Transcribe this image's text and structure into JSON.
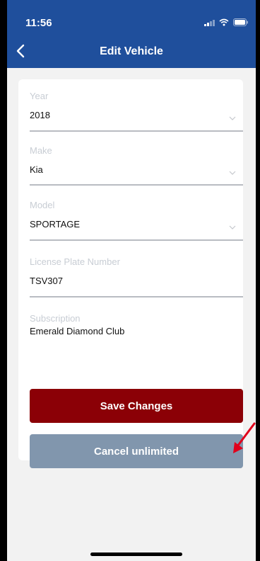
{
  "status_bar": {
    "time": "11:56"
  },
  "nav": {
    "title": "Edit Vehicle",
    "back_icon": "chevron-left-icon"
  },
  "form": {
    "year": {
      "label": "Year",
      "value": "2018"
    },
    "make": {
      "label": "Make",
      "value": "Kia"
    },
    "model": {
      "label": "Model",
      "value": "SPORTAGE"
    },
    "license_plate": {
      "label": "License Plate Number",
      "value": "TSV307"
    },
    "subscription": {
      "label": "Subscription",
      "value": "Emerald Diamond Club"
    }
  },
  "buttons": {
    "save": "Save Changes",
    "cancel": "Cancel unlimited"
  },
  "colors": {
    "header": "#1f4f9c",
    "save_button": "#8b0006",
    "cancel_button": "#8196ad",
    "annotation_arrow": "#e0001b"
  }
}
